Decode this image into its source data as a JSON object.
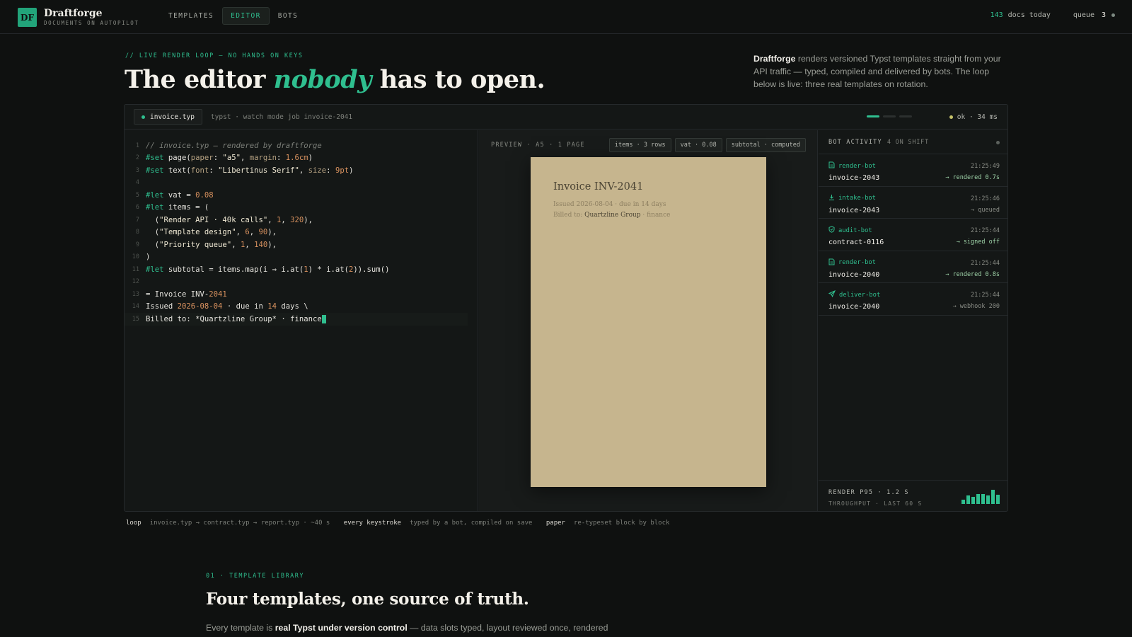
{
  "brand": {
    "logo": "DF",
    "name": "Draftforge",
    "tagline": "DOCUMENTS ON AUTOPILOT"
  },
  "nav": {
    "tabs": [
      "TEMPLATES",
      "EDITOR",
      "BOTS"
    ],
    "active": "EDITOR"
  },
  "top_stats": {
    "docs_count": "143",
    "docs_label": "docs today",
    "queue_label": "queue",
    "queue_count": "3"
  },
  "hero": {
    "eyebrow": "// LIVE RENDER LOOP — NO HANDS ON KEYS",
    "title_pre": "The editor ",
    "title_em": "nobody",
    "title_post": " has to open.",
    "desc_brand": "Draftforge",
    "desc_text": " renders versioned Typst templates straight from your API traffic — typed, compiled and delivered by bots. The loop below is live: three real templates on rotation."
  },
  "editor": {
    "file_tab": "invoice.typ",
    "meta": "typst · watch mode  job invoice-2041",
    "status": "ok · 34 ms",
    "pager_active": 1,
    "pager_total": 3
  },
  "preview": {
    "label": "PREVIEW · A5 · 1 PAGE",
    "chips": [
      "items · 3 rows",
      "vat · 0.08",
      "subtotal · computed"
    ],
    "paper": {
      "title": "Invoice INV-2041",
      "issued": "Issued 2026-08-04 · due in 14 days",
      "billed_prefix": "Billed to: ",
      "billed_name": "Quartzline Group",
      "billed_suffix": " · finance"
    }
  },
  "bots": {
    "title": "BOT ACTIVITY",
    "shift": "4 ON SHIFT",
    "items": [
      {
        "bot": "render-bot",
        "icon": "document-icon",
        "time": "21:25:49",
        "doc": "invoice-2043",
        "result": "→ rendered 0.7s",
        "ok": true
      },
      {
        "bot": "intake-bot",
        "icon": "download-icon",
        "time": "21:25:46",
        "doc": "invoice-2043",
        "result": "→ queued",
        "ok": false
      },
      {
        "bot": "audit-bot",
        "icon": "shield-icon",
        "time": "21:25:44",
        "doc": "contract-0116",
        "result": "→ signed off",
        "ok": true
      },
      {
        "bot": "render-bot",
        "icon": "document-icon",
        "time": "21:25:44",
        "doc": "invoice-2040",
        "result": "→ rendered 0.8s",
        "ok": true
      },
      {
        "bot": "deliver-bot",
        "icon": "send-icon",
        "time": "21:25:44",
        "doc": "invoice-2040",
        "result": "→ webhook 200",
        "ok": false
      }
    ],
    "footer_a": "RENDER P95 · 1.2 S",
    "footer_b": "THROUGHPUT · LAST 60 S",
    "throughput": [
      0.3,
      0.6,
      0.5,
      0.7,
      0.7,
      0.6,
      1.0,
      0.65
    ]
  },
  "loop_row": {
    "loop_label": "loop",
    "loop_text": "invoice.typ → contract.typ → report.typ · ~40 s",
    "key_label": "every keystroke",
    "key_text": "typed by a bot, compiled on save",
    "paper_label": "paper",
    "paper_text": "re-typeset block by block"
  },
  "section": {
    "eyebrow": "01 · TEMPLATE LIBRARY",
    "title": "Four templates, one source of truth.",
    "body_pre": "Every template is ",
    "body_bold": "real Typst under version control",
    "body_post": " — data slots typed, layout reviewed once, rendered"
  },
  "colors": {
    "accent": "#2fbf8f",
    "paper": "#c6b58e",
    "background": "#0f1110"
  }
}
